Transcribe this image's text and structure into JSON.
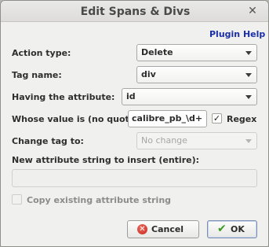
{
  "window": {
    "title": "Edit Spans & Divs",
    "close_glyph": "✕"
  },
  "help_link": "Plugin Help",
  "fields": {
    "action_type": {
      "label": "Action type:",
      "value": "Delete"
    },
    "tag_name": {
      "label": "Tag name:",
      "value": "div"
    },
    "having_attribute": {
      "label": "Having the attribute:",
      "value": "id"
    },
    "whose_value": {
      "label": "Whose value is (no quotes):",
      "value": "calibre_pb_\\d+"
    },
    "regex": {
      "label": "Regex",
      "checked": true,
      "check_glyph": "✓"
    },
    "change_tag": {
      "label": "Change tag to:",
      "value": "No change"
    },
    "new_attribute": {
      "label": "New attribute string to insert (entire):",
      "value": ""
    },
    "copy_existing": {
      "label": "Copy existing attribute string",
      "checked": false
    }
  },
  "buttons": {
    "cancel": {
      "label": "Cancel",
      "icon": "cancel-icon",
      "glyph": "✕"
    },
    "ok": {
      "label": "OK",
      "icon": "checkmark-icon",
      "glyph": "✔"
    }
  },
  "colors": {
    "link": "#1a2fa8",
    "cancel_icon": "#d8392b",
    "ok_icon": "#3a9a1f"
  }
}
